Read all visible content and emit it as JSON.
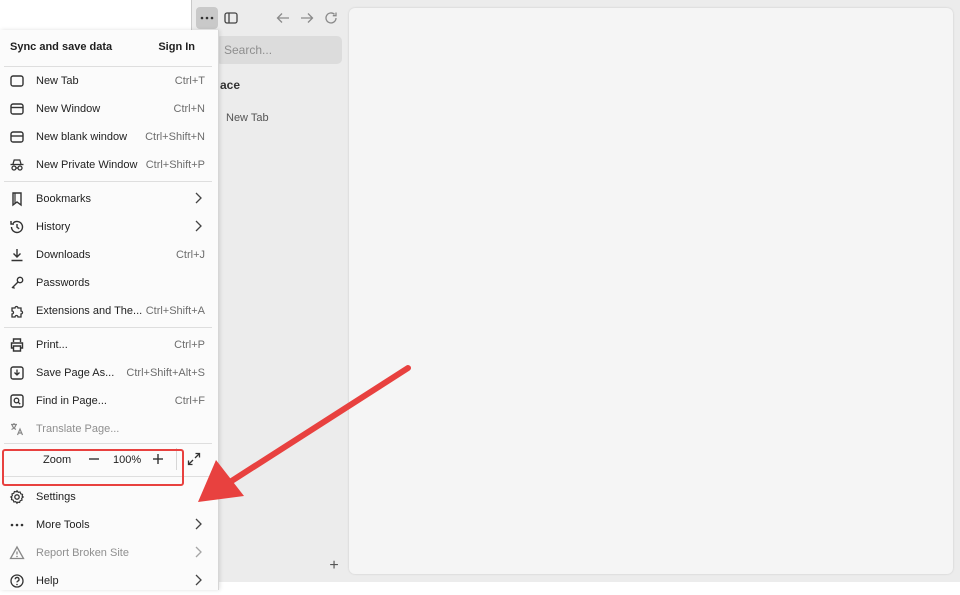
{
  "menu": {
    "header_title": "Sync and save data",
    "sign_in": "Sign In",
    "items": [
      {
        "label": "New Tab",
        "shortcut": "Ctrl+T",
        "icon": "tab-icon"
      },
      {
        "label": "New Window",
        "shortcut": "Ctrl+N",
        "icon": "window-icon"
      },
      {
        "label": "New blank window",
        "shortcut": "Ctrl+Shift+N",
        "icon": "blank-window-icon"
      },
      {
        "label": "New Private Window",
        "shortcut": "Ctrl+Shift+P",
        "icon": "private-mask-icon"
      },
      {
        "label": "Bookmarks",
        "shortcut": "",
        "icon": "bookmark-icon"
      },
      {
        "label": "History",
        "shortcut": "",
        "icon": "history-clock-icon"
      },
      {
        "label": "Downloads",
        "shortcut": "Ctrl+J",
        "icon": "download-icon"
      },
      {
        "label": "Passwords",
        "shortcut": "",
        "icon": "key-icon"
      },
      {
        "label": "Extensions and The...",
        "shortcut": "Ctrl+Shift+A",
        "icon": "puzzle-icon"
      },
      {
        "label": "Print...",
        "shortcut": "Ctrl+P",
        "icon": "printer-icon"
      },
      {
        "label": "Save Page As...",
        "shortcut": "Ctrl+Shift+Alt+S",
        "icon": "save-icon"
      },
      {
        "label": "Find in Page...",
        "shortcut": "Ctrl+F",
        "icon": "find-icon"
      },
      {
        "label": "Translate Page...",
        "shortcut": "",
        "icon": "translate-icon"
      },
      {
        "label": "Settings",
        "shortcut": "",
        "icon": "gear-icon"
      },
      {
        "label": "More Tools",
        "shortcut": "",
        "icon": "ellipsis-icon"
      },
      {
        "label": "Report Broken Site",
        "shortcut": "",
        "icon": "warning-icon"
      },
      {
        "label": "Help",
        "shortcut": "",
        "icon": "help-icon"
      }
    ],
    "zoom": {
      "label": "Zoom",
      "value": "100%",
      "minus": "−",
      "plus": "+"
    }
  },
  "browser": {
    "search_placeholder": "Search...",
    "space_label": "ace",
    "sidebar_tab": "New Tab",
    "add_tab": "+"
  },
  "colors": {
    "highlight": "#e8413f",
    "menu_bg": "#fbfbfb",
    "content_bg": "#f5f5f5"
  }
}
